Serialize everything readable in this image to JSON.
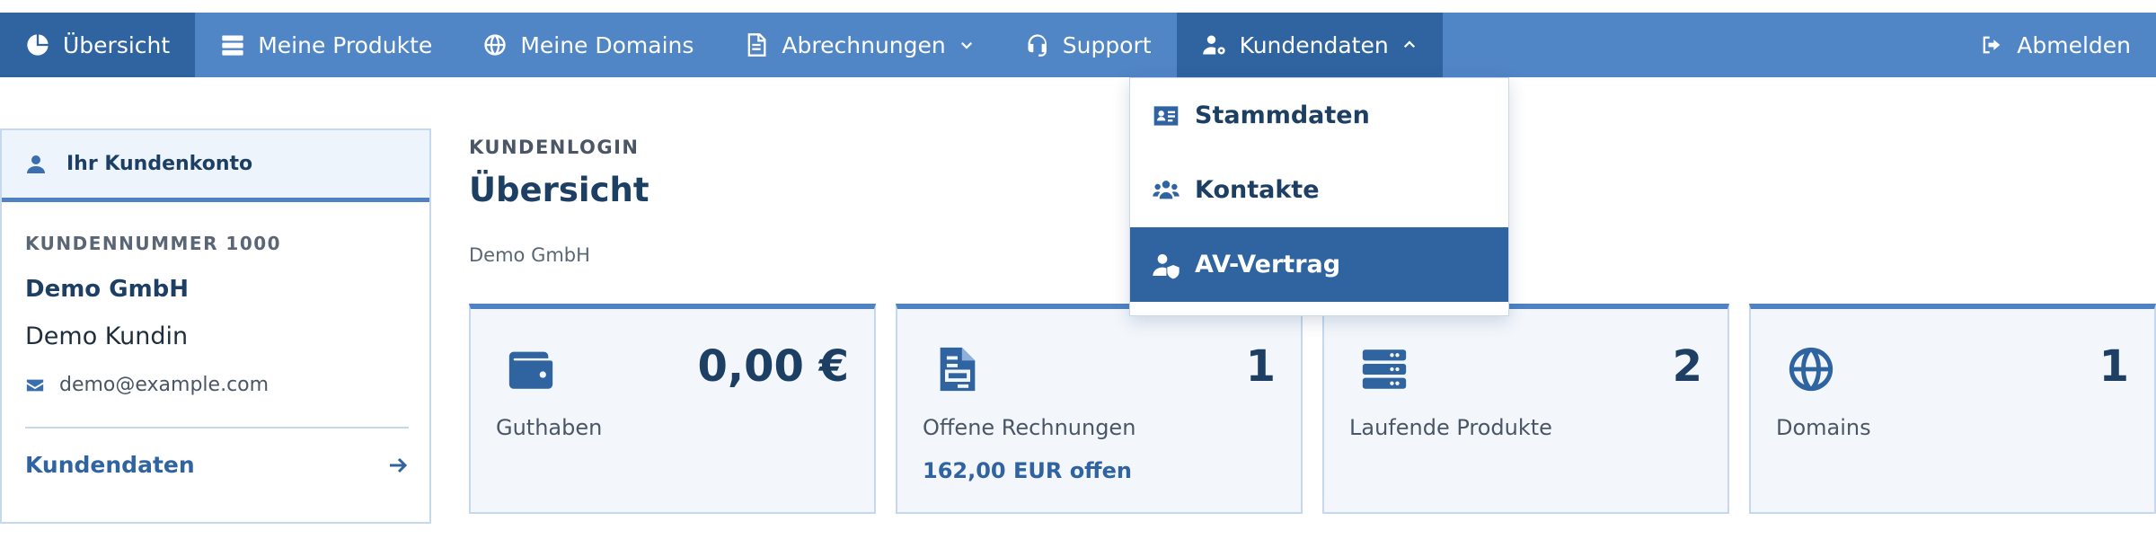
{
  "nav": {
    "overview": "Übersicht",
    "products": "Meine Produkte",
    "domains": "Meine Domains",
    "billing": "Abrechnungen",
    "support": "Support",
    "customer": "Kundendaten",
    "logout": "Abmelden"
  },
  "dropdown": {
    "items": [
      {
        "label": "Stammdaten"
      },
      {
        "label": "Kontakte"
      },
      {
        "label": "AV-Vertrag"
      }
    ]
  },
  "sidebar": {
    "title": "Ihr Kundenkonto",
    "customer_number": "KUNDENNUMMER 1000",
    "company": "Demo GmbH",
    "person": "Demo Kundin",
    "email": "demo@example.com",
    "link": "Kundendaten"
  },
  "main": {
    "eyebrow": "KUNDENLOGIN",
    "title": "Übersicht",
    "subtitle": "Demo GmbH"
  },
  "cards": [
    {
      "value": "0,00 €",
      "label": "Guthaben",
      "icon": "wallet-icon"
    },
    {
      "value": "1",
      "label": "Offene Rechnungen",
      "extra": "162,00 EUR offen",
      "icon": "invoice-icon"
    },
    {
      "value": "2",
      "label": "Laufende Produkte",
      "icon": "server-icon"
    },
    {
      "value": "1",
      "label": "Domains",
      "icon": "globe-icon"
    }
  ],
  "colors": {
    "nav_bg": "#5085c6",
    "nav_active": "#2f64a0",
    "title": "#1d3f64",
    "card_bg": "#f3f7fc"
  }
}
